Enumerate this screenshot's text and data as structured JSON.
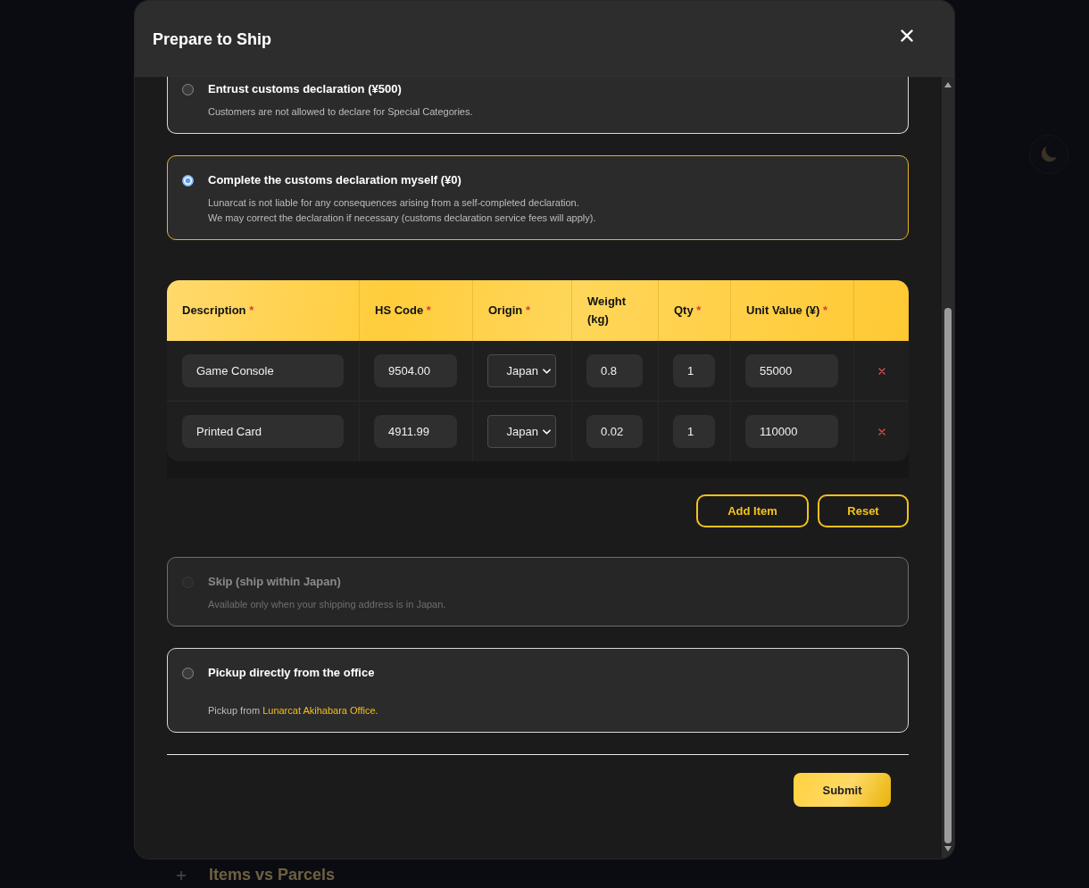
{
  "background": {
    "section_title": "Items vs Parcels"
  },
  "modal": {
    "title": "Prepare to Ship"
  },
  "declaration_options": [
    {
      "kind": "plain",
      "title": "Entrust customs declaration (¥500)",
      "description": [
        "Customers are not allowed to declare for Special Categories."
      ],
      "selected": false,
      "disabled": false
    },
    {
      "kind": "plain",
      "title": "Complete the customs declaration myself (¥0)",
      "description": [
        "Lunarcat is not liable for any consequences arising from a self-completed declaration.",
        "We may correct the declaration if necessary (customs declaration service fees will apply)."
      ],
      "selected": true,
      "disabled": false
    }
  ],
  "items_table": {
    "required_mark": "*",
    "columns": [
      {
        "label": "Description",
        "required": true
      },
      {
        "label": "HS Code",
        "required": true
      },
      {
        "label": "Origin",
        "required": true
      },
      {
        "label": "Weight (kg)",
        "required": false
      },
      {
        "label": "Qty",
        "required": true
      },
      {
        "label": "Unit Value (¥)",
        "required": true
      }
    ],
    "rows": [
      {
        "description": "Game Console",
        "hs_code": "9504.00",
        "origin": "Japan",
        "weight": "0.8",
        "qty": "1",
        "unit_value": "55000"
      },
      {
        "description": "Printed Card",
        "hs_code": "4911.99",
        "origin": "Japan",
        "weight": "0.02",
        "qty": "1",
        "unit_value": "110000"
      }
    ]
  },
  "table_actions": [
    {
      "label": "Add Item"
    },
    {
      "label": "Reset"
    }
  ],
  "other_options": [
    {
      "kind": "plain",
      "title": "Skip (ship within Japan)",
      "description": [
        "Available only when your shipping address is in Japan."
      ],
      "selected": false,
      "disabled": true
    },
    {
      "kind": "link",
      "title": "Pickup directly from the office",
      "description": {
        "before": "Pickup from ",
        "link": "Lunarcat Akihabara Office",
        "after": "."
      },
      "selected": false,
      "disabled": false
    }
  ],
  "submit": {
    "label": "Submit"
  }
}
